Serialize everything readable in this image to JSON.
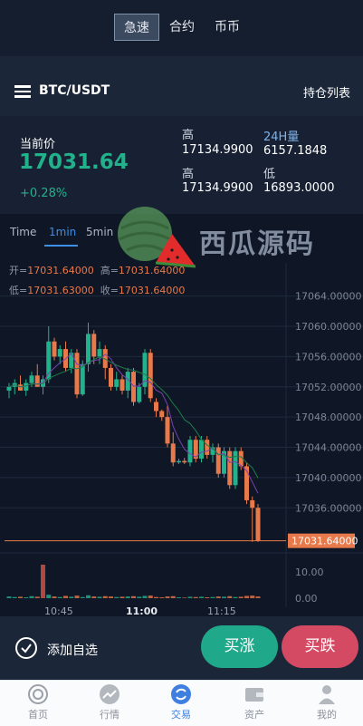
{
  "mode_tabs": [
    "急速",
    "合约",
    "币币"
  ],
  "pair": {
    "name": "BTC/USDT",
    "positions_link": "持仓列表"
  },
  "price": {
    "label": "当前价",
    "value": "17031.64",
    "change": "+0.28%"
  },
  "stats": [
    {
      "label": "高",
      "value": "17134.9900",
      "label_color": "#cfd6e0"
    },
    {
      "label": "24H量",
      "value": "6157.1848",
      "label_color": "#7fb1e8"
    },
    {
      "label": "高",
      "value": "17134.9900",
      "label_color": "#cfd6e0"
    },
    {
      "label": "低",
      "value": "16893.0000",
      "label_color": "#cfd6e0"
    }
  ],
  "timeframes": [
    "Time",
    "1min",
    "5min"
  ],
  "active_timeframe": "1min",
  "watermark": "西瓜源码",
  "ohlc": {
    "open_label": "开=",
    "open": "17031.64000",
    "high_label": "高=",
    "high": "17031.64000",
    "low_label": "低=",
    "low": "17031.63000",
    "close_label": "收=",
    "close": "17031.64000"
  },
  "chart_data": {
    "type": "candlestick",
    "y_ticks": [
      "17064.00000",
      "17060.00000",
      "17056.00000",
      "17052.00000",
      "17048.00000",
      "17044.00000",
      "17040.00000",
      "17036.00000"
    ],
    "y_range": [
      17031.0,
      17066.0
    ],
    "last_price_label": "17031.64000",
    "last_price": 17031.64,
    "x_ticks": [
      "10:45",
      "11:00",
      "11:15"
    ],
    "volume_ticks": [
      "10.00",
      "0.00"
    ],
    "candles": [
      [
        17051.5,
        17052.5,
        17050.5,
        17052.0
      ],
      [
        17052.0,
        17053.0,
        17051.0,
        17052.5
      ],
      [
        17052.3,
        17053.5,
        17051.8,
        17051.5
      ],
      [
        17051.5,
        17053.0,
        17050.8,
        17052.5
      ],
      [
        17052.5,
        17054.0,
        17052.0,
        17053.5
      ],
      [
        17053.5,
        17055.0,
        17052.8,
        17052.0
      ],
      [
        17052.0,
        17053.5,
        17051.0,
        17053.0
      ],
      [
        17053.0,
        17060.0,
        17052.5,
        17058.0
      ],
      [
        17058.0,
        17058.5,
        17055.5,
        17056.0
      ],
      [
        17056.0,
        17057.5,
        17055.0,
        17057.0
      ],
      [
        17057.0,
        17058.0,
        17054.0,
        17054.5
      ],
      [
        17054.5,
        17057.0,
        17053.8,
        17056.5
      ],
      [
        17056.5,
        17057.0,
        17050.5,
        17051.0
      ],
      [
        17051.0,
        17055.5,
        17050.8,
        17055.0
      ],
      [
        17055.0,
        17060.5,
        17054.0,
        17059.0
      ],
      [
        17059.0,
        17059.5,
        17055.0,
        17056.0
      ],
      [
        17056.0,
        17058.0,
        17055.0,
        17057.0
      ],
      [
        17057.0,
        17057.5,
        17053.0,
        17054.5
      ],
      [
        17054.5,
        17055.0,
        17051.5,
        17052.0
      ],
      [
        17052.0,
        17054.0,
        17051.5,
        17053.0
      ],
      [
        17053.0,
        17053.5,
        17051.0,
        17051.5
      ],
      [
        17051.5,
        17054.5,
        17050.5,
        17054.0
      ],
      [
        17054.0,
        17054.5,
        17049.5,
        17050.0
      ],
      [
        17050.0,
        17052.5,
        17049.8,
        17052.0
      ],
      [
        17052.0,
        17057.0,
        17051.0,
        17056.5
      ],
      [
        17056.5,
        17057.0,
        17050.0,
        17050.5
      ],
      [
        17050.0,
        17050.5,
        17048.0,
        17048.8
      ],
      [
        17048.8,
        17049.0,
        17047.5,
        17048.0
      ],
      [
        17048.0,
        17049.5,
        17044.0,
        17044.5
      ],
      [
        17044.5,
        17046.0,
        17041.5,
        17042.0
      ],
      [
        17042.0,
        17042.5,
        17041.8,
        17042.2
      ],
      [
        17042.2,
        17042.6,
        17041.8,
        17042.0
      ],
      [
        17042.0,
        17045.5,
        17041.5,
        17045.0
      ],
      [
        17045.0,
        17045.5,
        17042.0,
        17042.5
      ],
      [
        17042.5,
        17045.5,
        17042.0,
        17045.0
      ],
      [
        17045.0,
        17045.5,
        17042.5,
        17043.0
      ],
      [
        17043.0,
        17044.5,
        17042.0,
        17044.0
      ],
      [
        17044.0,
        17044.5,
        17040.0,
        17040.5
      ],
      [
        17040.5,
        17044.0,
        17040.0,
        17043.5
      ],
      [
        17043.5,
        17044.0,
        17038.5,
        17039.0
      ],
      [
        17039.0,
        17044.0,
        17038.5,
        17043.5
      ],
      [
        17043.5,
        17044.0,
        17041.0,
        17041.5
      ],
      [
        17041.5,
        17042.0,
        17036.5,
        17037.0
      ],
      [
        17037.0,
        17037.5,
        17031.5,
        17036.0
      ],
      [
        17036.0,
        17036.5,
        17031.5,
        17031.64
      ]
    ],
    "volumes": [
      0.6,
      0.4,
      0.5,
      0.3,
      0.7,
      0.5,
      0.4,
      1.2,
      0.6,
      0.4,
      0.8,
      0.5,
      0.9,
      0.4,
      1.0,
      0.6,
      0.5,
      0.7,
      0.6,
      0.4,
      0.5,
      0.6,
      0.7,
      0.5,
      0.8,
      0.9,
      0.4,
      0.3,
      0.6,
      0.7,
      0.3,
      0.2,
      0.5,
      0.4,
      0.5,
      0.3,
      0.4,
      0.6,
      0.5,
      0.7,
      0.4,
      0.5,
      0.8,
      0.9,
      0.6
    ],
    "volume_spike": 12.5
  },
  "actions": {
    "favorite": "添加自选",
    "buy": "买涨",
    "sell": "买跌"
  },
  "nav": [
    {
      "label": "首页",
      "icon": "home-icon"
    },
    {
      "label": "行情",
      "icon": "market-icon"
    },
    {
      "label": "交易",
      "icon": "trade-icon"
    },
    {
      "label": "资产",
      "icon": "wallet-icon"
    },
    {
      "label": "我的",
      "icon": "profile-icon"
    }
  ],
  "active_nav": "交易",
  "colors": {
    "up": "#22b28b",
    "down": "#e8794a",
    "accent": "#3f8fe6",
    "sell": "#d54a63"
  }
}
